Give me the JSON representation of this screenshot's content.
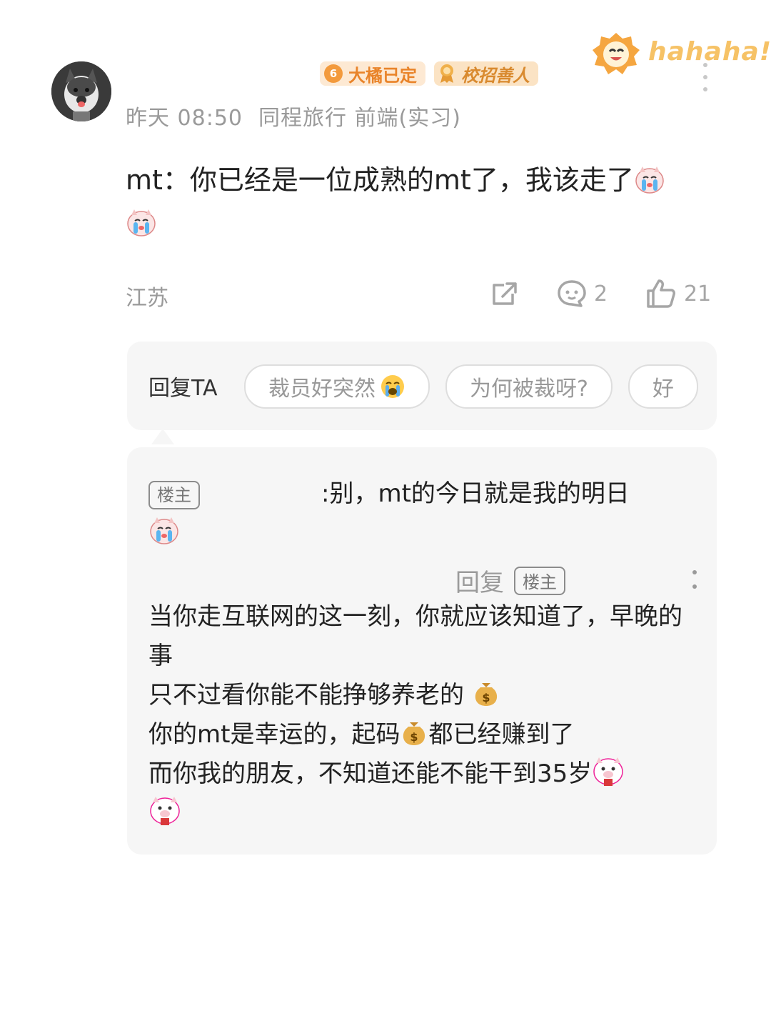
{
  "header": {
    "badges": [
      {
        "level": "6",
        "label": "大橘已定"
      },
      {
        "label": "校招善人"
      }
    ],
    "time": "昨天 08:50",
    "company": "同程旅行 前端(实习)",
    "sticker_text": "hahaha!"
  },
  "post": {
    "text": "mt：你已经是一位成熟的mt了，我该走了"
  },
  "footer": {
    "location": "江苏",
    "comment_count": "2",
    "like_count": "21"
  },
  "quick_reply": {
    "label": "回复TA",
    "chips": [
      "裁员好突然",
      "为何被裁呀?",
      "好"
    ]
  },
  "replies": {
    "op_tag": "楼主",
    "reply1_text": ":别，mt的今日就是我的明日",
    "reply2_action": "回复",
    "reply2_tag": "楼主",
    "reply2_lines": [
      "当你走互联网的这一刻，你就应该知道了，早晚的事",
      "只不过看你能不能挣够养老的",
      "你的mt是幸运的，起码",
      "都已经赚到了",
      "而你我的朋友，不知道还能不能干到35岁"
    ]
  },
  "icons": [
    "share-icon",
    "comment-icon",
    "like-icon",
    "cry-emoji-icon",
    "money-bag-icon",
    "pig-emoji-icon",
    "more-icon"
  ],
  "colors": {
    "accent_orange": "#f39a3c",
    "muted_text": "#9a9a9a",
    "panel_bg": "#f6f6f6"
  }
}
